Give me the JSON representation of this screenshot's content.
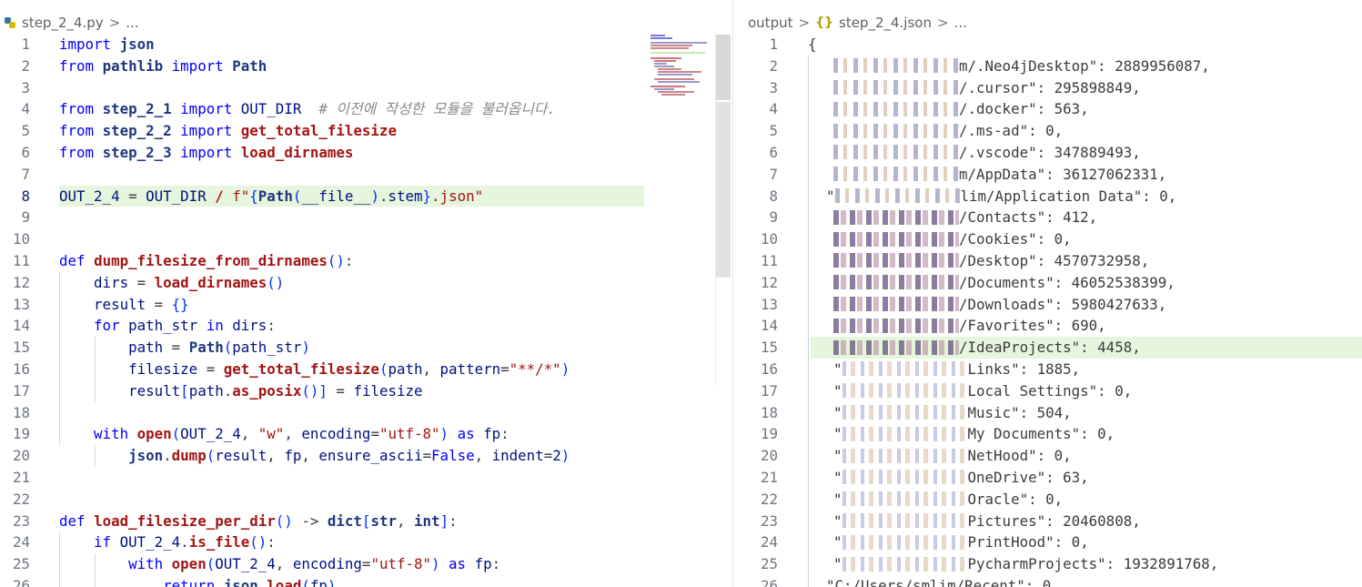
{
  "left": {
    "breadcrumb": {
      "file": "step_2_4.py",
      "sep": ">",
      "more": "..."
    }
  },
  "right": {
    "breadcrumb": {
      "folder": "output",
      "file": "step_2_4.json",
      "sep1": ">",
      "sep2": ">",
      "more": "..."
    },
    "lines": [
      {
        "n": "1",
        "t": "{"
      },
      {
        "n": "2",
        "t": "m/.Neo4jDesktop\": 2889956087,"
      },
      {
        "n": "3",
        "t": "/.cursor\": 295898849,"
      },
      {
        "n": "4",
        "t": "/.docker\": 563,"
      },
      {
        "n": "5",
        "t": "/.ms-ad\": 0,"
      },
      {
        "n": "6",
        "t": "/.vscode\": 347889493,"
      },
      {
        "n": "7",
        "t": "m/AppData\": 36127062331,"
      },
      {
        "n": "8",
        "t": "lim/Application Data\": 0,"
      },
      {
        "n": "9",
        "t": "/Contacts\": 412,"
      },
      {
        "n": "10",
        "t": "/Cookies\": 0,"
      },
      {
        "n": "11",
        "t": "/Desktop\": 4570732958,"
      },
      {
        "n": "12",
        "t": "/Documents\": 46052538399,"
      },
      {
        "n": "13",
        "t": "/Downloads\": 5980427633,"
      },
      {
        "n": "14",
        "t": "/Favorites\": 690,"
      },
      {
        "n": "15",
        "t": "/IdeaProjects\": 4458,"
      },
      {
        "n": "16",
        "t": "Links\": 1885,"
      },
      {
        "n": "17",
        "t": "Local Settings\": 0,"
      },
      {
        "n": "18",
        "t": "Music\": 504,"
      },
      {
        "n": "19",
        "t": "My Documents\": 0,"
      },
      {
        "n": "20",
        "t": "NetHood\": 0,"
      },
      {
        "n": "21",
        "t": "OneDrive\": 63,"
      },
      {
        "n": "22",
        "t": "Oracle\": 0,"
      },
      {
        "n": "23",
        "t": "Pictures\": 20460808,"
      },
      {
        "n": "24",
        "t": "PrintHood\": 0,"
      },
      {
        "n": "25",
        "t": "PycharmProjects\": 1932891768,"
      },
      {
        "n": "26",
        "t": "\"C:/Users/smlim/Recent\": 0,"
      }
    ]
  },
  "colors": {
    "line_highlight": "#e6f6dc",
    "keyword": "#0000ff",
    "function": "#a31515"
  }
}
